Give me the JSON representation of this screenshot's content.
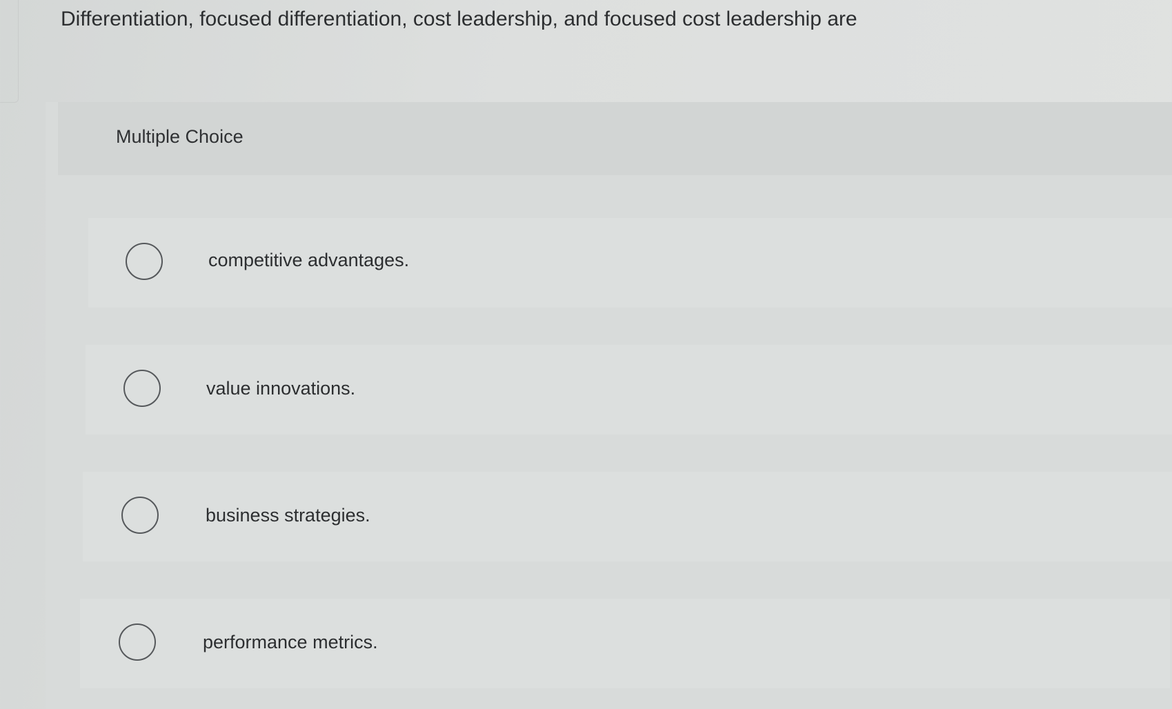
{
  "question": {
    "text": "Differentiation, focused differentiation, cost leadership, and focused cost leadership are"
  },
  "question_type": "Multiple Choice",
  "options": [
    {
      "label": "competitive advantages.",
      "selected": false
    },
    {
      "label": "value innovations.",
      "selected": false
    },
    {
      "label": "business strategies.",
      "selected": false
    },
    {
      "label": "performance metrics.",
      "selected": false
    }
  ],
  "colors": {
    "background": "#dddfde",
    "text": "#2c2e30",
    "radio_border": "#55585b"
  }
}
